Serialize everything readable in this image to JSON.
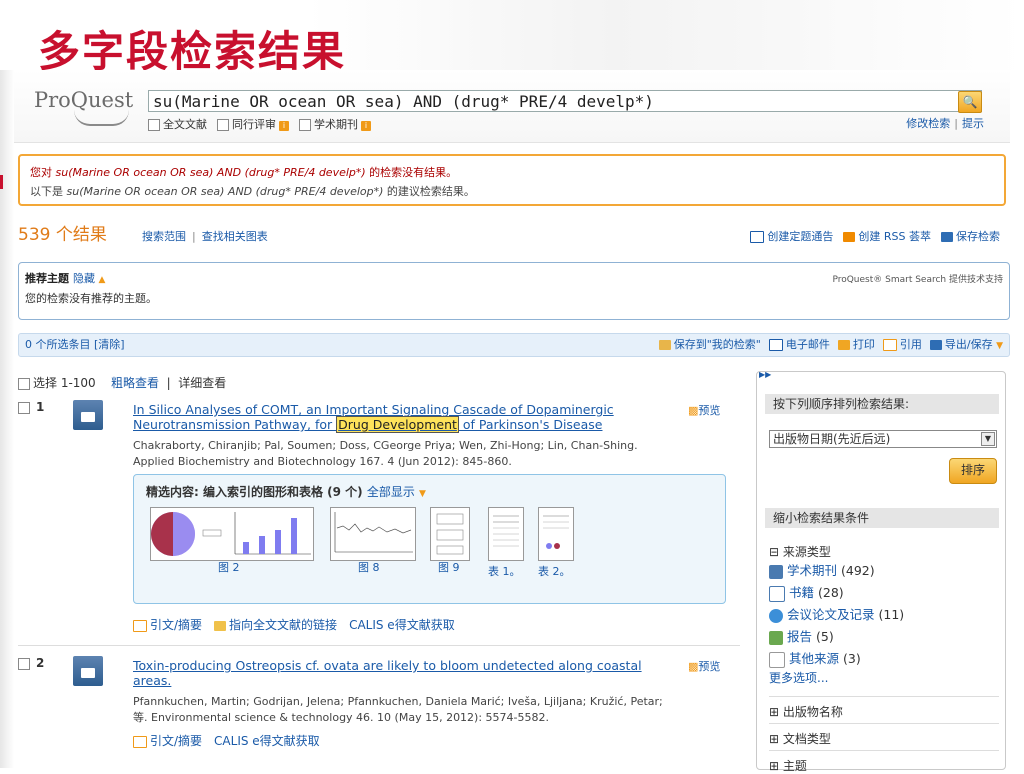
{
  "slide_title": "多字段检索结果",
  "logo": "ProQuest",
  "search": {
    "query": "su(Marine OR ocean OR sea) AND (drug* PRE/4 develp*)",
    "options": [
      "全文文献",
      "同行评审",
      "学术期刊"
    ],
    "modify": "修改检索",
    "tips": "提示"
  },
  "warning": {
    "line1_prefix": "您对 ",
    "line1_query": "su(Marine OR ocean OR sea) AND (drug* PRE/4 develp*)",
    "line1_suffix": " 的检索没有结果。",
    "line2_prefix": "以下是 ",
    "line2_query": "su(Marine OR ocean OR sea) AND (drug* PRE/4 develop*)",
    "line2_suffix": " 的建议检索结果。"
  },
  "results_count": "539",
  "results_unit": "个结果",
  "scope_links": [
    "搜索范围",
    "查找相关图表"
  ],
  "top_actions": [
    "创建定题通告",
    "创建 RSS 荟萃",
    "保存检索"
  ],
  "topics": {
    "title": "推荐主题",
    "hide": "隐藏",
    "none": "您的检索没有推荐的主题。",
    "smart": "ProQuest® Smart Search 提供技术支持"
  },
  "selbar": {
    "selected": "0 个所选条目 [清除]",
    "actions": [
      "保存到\"我的检索\"",
      "电子邮件",
      "打印",
      "引用",
      "导出/保存"
    ]
  },
  "list_head": {
    "select": "选择 1-100",
    "brief": "粗略查看",
    "detail": "详细查看"
  },
  "results": [
    {
      "num": "1",
      "title_before": "In Silico Analyses of COMT, an Important Signaling Cascade of Dopaminergic Neurotransmission Pathway, for ",
      "title_hl": "Drug Development",
      "title_after": " of Parkinson's Disease",
      "preview": "预览",
      "authors": "Chakraborty, Chiranjib; Pal, Soumen; Doss, CGeorge Priya; Wen, Zhi-Hong; Lin, Chan-Shing.",
      "source": "Applied Biochemistry and Biotechnology 167. 4 (Jun 2012): 845-860.",
      "fig_header": "精选内容: 编入索引的图形和表格 (9 个)",
      "fig_showall": "全部显示",
      "fig_captions": [
        "图 2",
        "图 8",
        "图 9",
        "表 1。",
        "表 2。"
      ],
      "links": [
        "引文/摘要",
        "指向全文文献的链接",
        "CALIS e得文献获取"
      ]
    },
    {
      "num": "2",
      "title": "Toxin-producing Ostreopsis cf. ovata are likely to bloom undetected along coastal areas.",
      "preview": "预览",
      "authors": "Pfannkuchen, Martin; Godrijan, Jelena; Pfannkuchen, Daniela Marić; Iveša, Ljiljana; Kružić, Petar;",
      "source": "等. Environmental science & technology 46. 10 (May 15, 2012): 5574-5582.",
      "links": [
        "引文/摘要",
        "CALIS e得文献获取"
      ]
    }
  ],
  "sidebar": {
    "sort_header": "按下列顺序排列检索结果:",
    "sort_value": "出版物日期(先近后远)",
    "sort_button": "排序",
    "narrow_header": "缩小检索结果条件",
    "source_type": "来源类型",
    "sources": [
      {
        "label": "学术期刊",
        "count": "(492)"
      },
      {
        "label": "书籍",
        "count": "(28)"
      },
      {
        "label": "会议论文及记录",
        "count": "(11)"
      },
      {
        "label": "报告",
        "count": "(5)"
      },
      {
        "label": "其他来源",
        "count": "(3)"
      }
    ],
    "more": "更多选项...",
    "sections": [
      "出版物名称",
      "文档类型",
      "主题"
    ]
  },
  "colors": {
    "title_red": "#c8102e",
    "link_blue": "#1a5aa8",
    "accent_orange": "#f09a18"
  }
}
